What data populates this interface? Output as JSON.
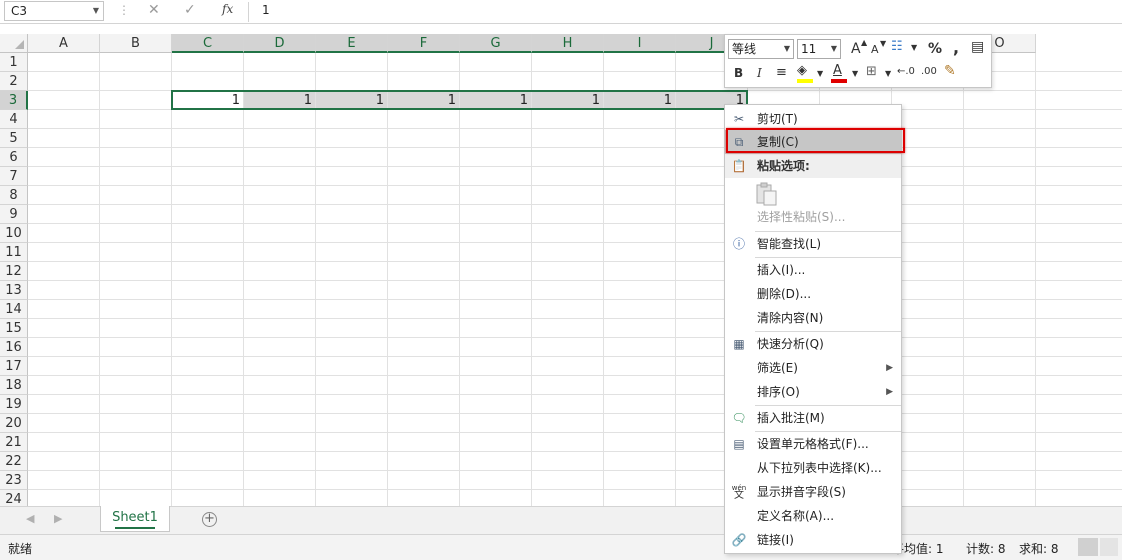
{
  "formula_bar": {
    "name_box": "C3",
    "fx": "fx",
    "value": "1"
  },
  "columns": [
    "A",
    "B",
    "C",
    "D",
    "E",
    "F",
    "G",
    "H",
    "I",
    "J",
    "",
    "",
    "N",
    "O"
  ],
  "rows": [
    "1",
    "2",
    "3",
    "4",
    "5",
    "6",
    "7",
    "8",
    "9",
    "10",
    "11",
    "12",
    "13",
    "14",
    "15",
    "16",
    "17",
    "18",
    "19",
    "20",
    "21",
    "22",
    "23",
    "24"
  ],
  "selection": {
    "range": "C3:J3",
    "row": "3"
  },
  "cell_values": [
    "1",
    "1",
    "1",
    "1",
    "1",
    "1",
    "1",
    "1"
  ],
  "sheet_tab": "Sheet1",
  "status": {
    "ready": "就绪",
    "average": "平均值: 1",
    "count": "计数: 8",
    "sum": "求和: 8"
  },
  "mini_toolbar": {
    "font_name": "等线",
    "font_size": "11",
    "grow_font": "A",
    "shrink_font": "A",
    "percent": "%",
    "comma": ",",
    "bold": "B",
    "italic": "I",
    "font_color": "A",
    "increase_decimal": "←.0",
    "decrease_decimal": ".00",
    "accent_fill": "#ffff00",
    "accent_font": "#e00000"
  },
  "context_menu": {
    "cut": "剪切(T)",
    "copy": "复制(C)",
    "paste_options": "粘贴选项:",
    "paste_special": "选择性粘贴(S)...",
    "smart_lookup": "智能查找(L)",
    "insert": "插入(I)...",
    "delete": "删除(D)...",
    "clear_contents": "清除内容(N)",
    "quick_analysis": "快速分析(Q)",
    "filter": "筛选(E)",
    "sort": "排序(O)",
    "insert_comment": "插入批注(M)",
    "format_cells": "设置单元格格式(F)...",
    "pick_from_list": "从下拉列表中选择(K)...",
    "phonetic": "显示拼音字段(S)",
    "define_name": "定义名称(A)...",
    "link": "链接(I)",
    "phonetic_icon_text": "wén",
    "phonetic_icon_char": "文"
  }
}
